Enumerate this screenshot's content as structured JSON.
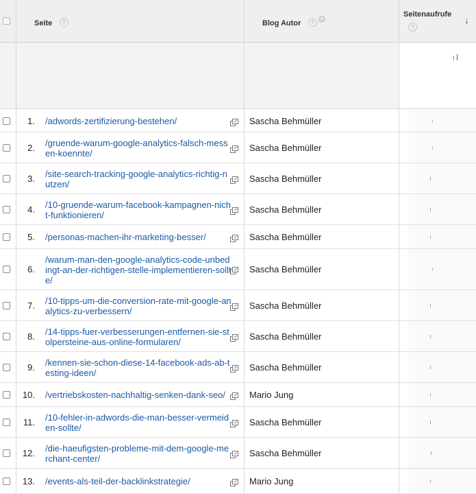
{
  "header": {
    "col_page": "Seite",
    "col_author": "Blog Autor",
    "col_views": "Seitenaufrufe",
    "help_glyph": "?",
    "remove_glyph": "×",
    "sort_glyph": "↓"
  },
  "rows": [
    {
      "rank": "1.",
      "page": "/adwords-zertifizierung-bestehen/",
      "author": "Sascha Behmüller"
    },
    {
      "rank": "2.",
      "page": "/gruende-warum-google-analytics-falsch-messen-koennte/",
      "author": "Sascha Behmüller"
    },
    {
      "rank": "3.",
      "page": "/site-search-tracking-google-analytics-richtig-nutzen/",
      "author": "Sascha Behmüller"
    },
    {
      "rank": "4.",
      "page": "/10-gruende-warum-facebook-kampagnen-nicht-funktionieren/",
      "author": "Sascha Behmüller"
    },
    {
      "rank": "5.",
      "page": "/personas-machen-ihr-marketing-besser/",
      "author": "Sascha Behmüller"
    },
    {
      "rank": "6.",
      "page": "/warum-man-den-google-analytics-code-unbedingt-an-der-richtigen-stelle-implementieren-sollte/",
      "author": "Sascha Behmüller"
    },
    {
      "rank": "7.",
      "page": "/10-tipps-um-die-conversion-rate-mit-google-analytics-zu-verbessern/",
      "author": "Sascha Behmüller"
    },
    {
      "rank": "8.",
      "page": "/14-tipps-fuer-verbesserungen-entfernen-sie-stolpersteine-aus-online-formularen/",
      "author": "Sascha Behmüller"
    },
    {
      "rank": "9.",
      "page": "/kennen-sie-schon-diese-14-facebook-ads-ab-testing-ideen/",
      "author": "Sascha Behmüller"
    },
    {
      "rank": "10.",
      "page": "/vertriebskosten-nachhaltig-senken-dank-seo/",
      "author": "Mario Jung"
    },
    {
      "rank": "11.",
      "page": "/10-fehler-in-adwords-die-man-besser-vermeiden-sollte/",
      "author": "Sascha Behmüller"
    },
    {
      "rank": "12.",
      "page": "/die-haeufigsten-probleme-mit-dem-google-merchant-center/",
      "author": "Sascha Behmüller"
    },
    {
      "rank": "13.",
      "page": "/events-als-teil-der-backlinkstrategie/",
      "author": "Mario Jung"
    }
  ]
}
